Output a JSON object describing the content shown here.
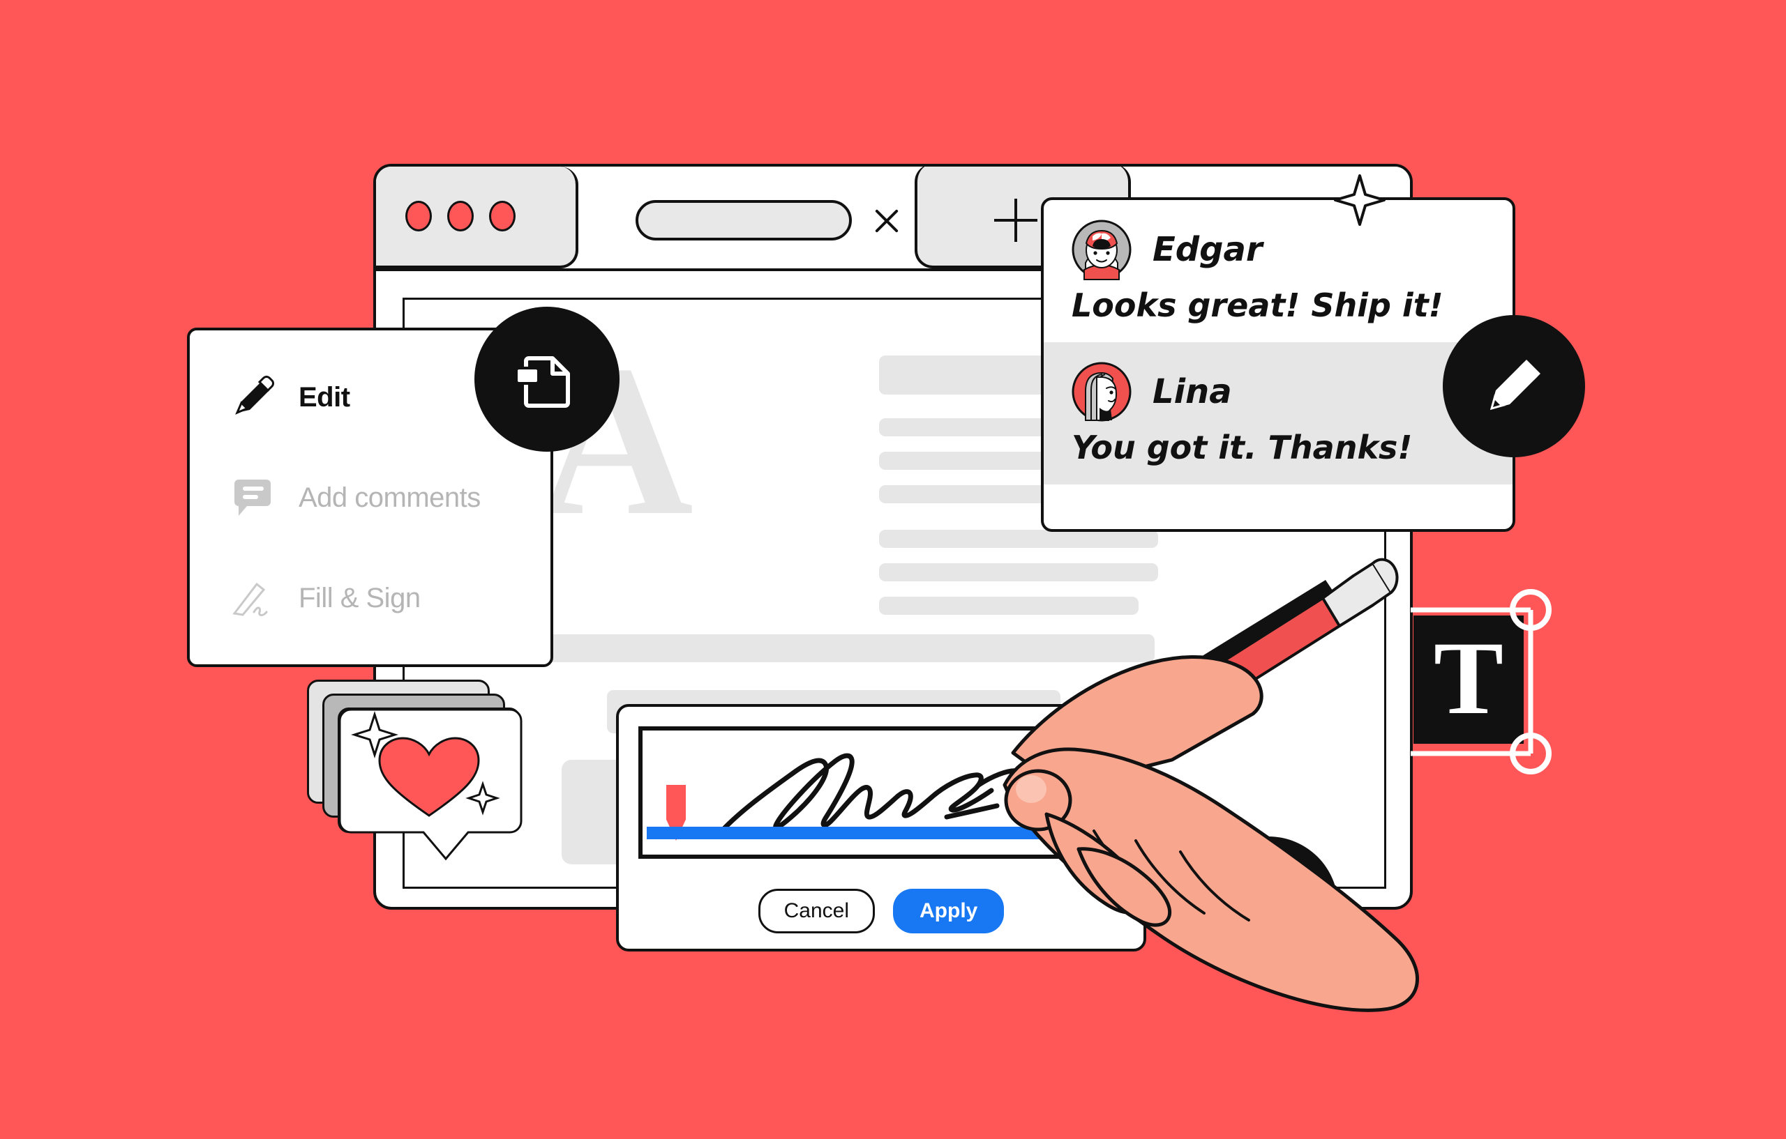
{
  "theme": {
    "background": "#FF5757",
    "accent_red": "#FF5757",
    "ink": "#111111",
    "muted_gray": "#B5B5B5",
    "panel_gray": "#E6E6E6",
    "apply_blue": "#1877F2",
    "signature_underline_blue": "#1877F2"
  },
  "browser": {
    "traffic_lights": [
      "close",
      "minimize",
      "maximize"
    ],
    "active_tab_label": "",
    "close_tab_label": "×",
    "new_tab_label": "+"
  },
  "document": {
    "drop_cap": "A",
    "placeholder_lines": 8,
    "placeholder_cards": 3
  },
  "edit_menu": {
    "items": [
      {
        "label": "Edit",
        "icon": "pencil-icon",
        "state": "active"
      },
      {
        "label": "Add comments",
        "icon": "comment-icon",
        "state": "muted"
      },
      {
        "label": "Fill & Sign",
        "icon": "signature-icon",
        "state": "muted"
      }
    ]
  },
  "comments": {
    "entries": [
      {
        "name": "Edgar",
        "text": "Looks great! Ship it!",
        "avatar": "edgar-avatar",
        "avatar_bg": "#B8B8B8",
        "highlighted": false
      },
      {
        "name": "Lina",
        "text": "You got it. Thanks!",
        "avatar": "lina-avatar",
        "avatar_bg": "#F0504E",
        "highlighted": true
      }
    ]
  },
  "signature_dialog": {
    "cancel_label": "Cancel",
    "apply_label": "Apply",
    "field_placeholder": "",
    "signature_present": true
  },
  "badges": [
    {
      "name": "file-badge",
      "icon": "document-copy-icon"
    },
    {
      "name": "pencil-badge",
      "icon": "pencil-icon"
    },
    {
      "name": "comment-star-badge",
      "icon": "comment-sparkle-icon"
    }
  ],
  "decorations": {
    "heart_card": {
      "icon": "heart-icon",
      "stack_count": 3,
      "sparkles": 2
    },
    "text_box": {
      "glyph": "T",
      "handles": 2
    },
    "panel_sparkle": "four-point-star-icon"
  }
}
